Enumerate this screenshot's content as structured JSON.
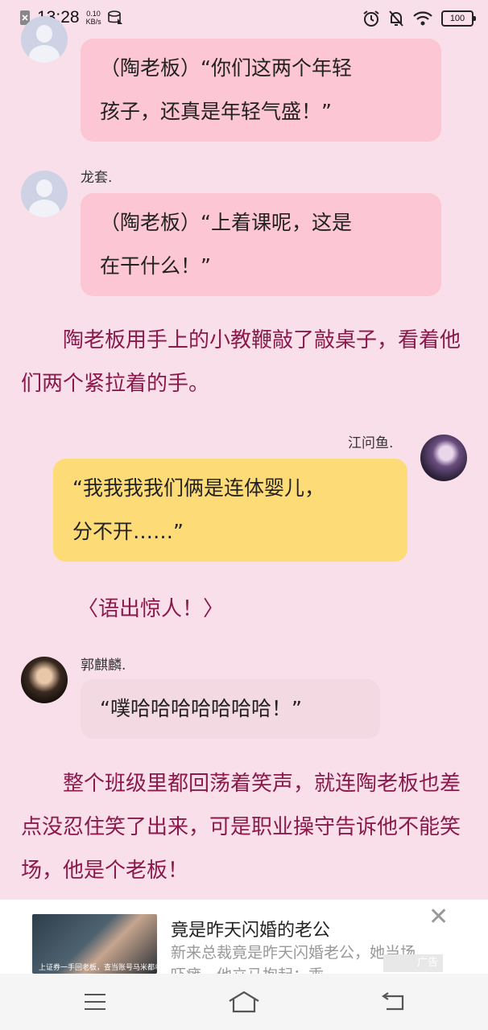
{
  "status_bar": {
    "time": "13:28",
    "net_speed_value": "0.10",
    "net_speed_unit": "KB/s",
    "battery": "100"
  },
  "chat": [
    {
      "speaker": "",
      "text_l1": "（陶老板）“你们这两个年轻",
      "text_l2": "孩子，还真是年轻气盛！”"
    },
    {
      "speaker": "龙套.",
      "text_l1": "（陶老板）“上着课呢，这是",
      "text_l2": "在干什么！”"
    }
  ],
  "narration_1": "陶老板用手上的小教鞭敲了敲桌子，看着他们两个紧拉着的手。",
  "jiang": {
    "speaker": "江问鱼.",
    "text_l1": "“我我我我们俩是连体婴儿，",
    "text_l2": "分不开……”"
  },
  "aside": "〈语出惊人！〉",
  "guo": {
    "speaker": "郭麒麟.",
    "text": "“噗哈哈哈哈哈哈哈！”"
  },
  "narration_2": "整个班级里都回荡着笑声，就连陶老板也差点没忍住笑了出来，可是职业操守告诉他不能笑场，他是个老板！",
  "ad": {
    "title": "竟是昨天闪婚的老公",
    "description": "新来总裁竟是昨天闪婚老公，她当场吓瘫，他立马抱起：乖",
    "thumb_caption": "上证券一手回老板，查当账号马米都老公",
    "tag": "广告"
  },
  "colors": {
    "background": "#f9dfe9",
    "narration": "#8a1a4c",
    "bubble_pink": "#fcc6d4",
    "bubble_yellow": "#fddc78"
  }
}
